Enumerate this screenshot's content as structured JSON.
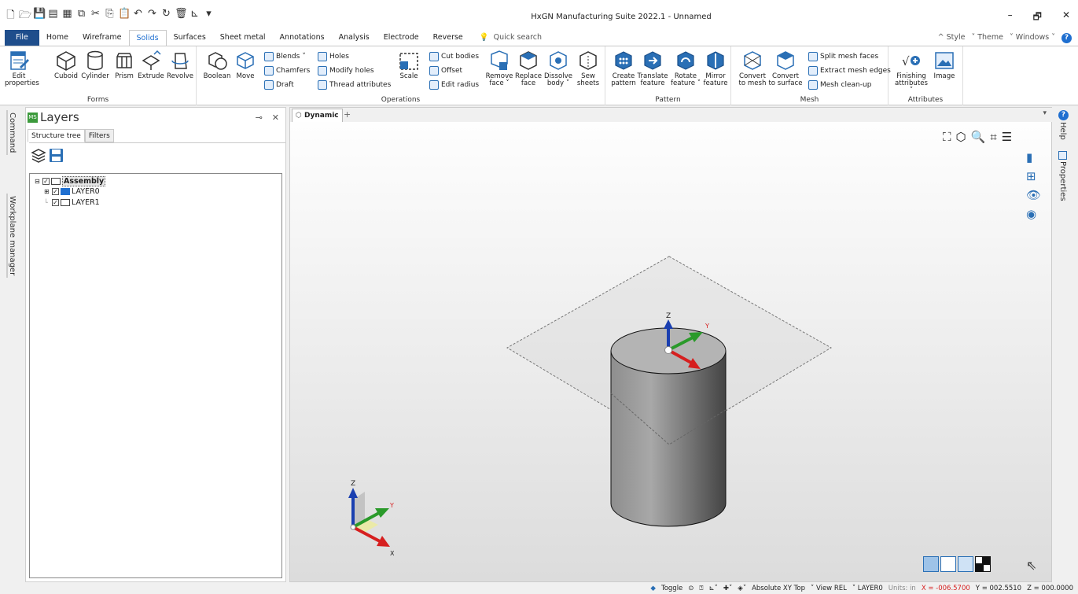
{
  "app": {
    "title": "HxGN Manufacturing Suite 2022.1 - Unnamed"
  },
  "tabs": [
    "File",
    "Home",
    "Wireframe",
    "Solids",
    "Surfaces",
    "Sheet metal",
    "Annotations",
    "Analysis",
    "Electrode",
    "Reverse"
  ],
  "active_tab": "Solids",
  "quick_search": "Quick search",
  "tab_right": {
    "style": "Style",
    "theme": "Theme",
    "windows": "Windows"
  },
  "ribbon": {
    "forms": {
      "label": "Forms",
      "edit": "Edit",
      "edit2": "properties",
      "cuboid": "Cuboid",
      "cylinder": "Cylinder",
      "prism": "Prism",
      "extrude": "Extrude",
      "revolve": "Revolve"
    },
    "operations": {
      "label": "Operations",
      "boolean": "Boolean",
      "move": "Move",
      "blends": "Blends",
      "chamfers": "Chamfers",
      "draft": "Draft",
      "holes": "Holes",
      "modify_holes": "Modify holes",
      "thread": "Thread attributes",
      "scale": "Scale",
      "cut": "Cut bodies",
      "offset": "Offset",
      "edit_radius": "Edit radius",
      "remove": "Remove",
      "remove2": "face",
      "replace": "Replace",
      "replace2": "face",
      "dissolve": "Dissolve",
      "dissolve2": "body",
      "sew": "Sew",
      "sew2": "sheets"
    },
    "pattern": {
      "label": "Pattern",
      "create": "Create",
      "create2": "pattern",
      "translate": "Translate",
      "translate2": "feature",
      "rotate": "Rotate",
      "rotate2": "feature",
      "mirror": "Mirror",
      "mirror2": "feature"
    },
    "mesh": {
      "label": "Mesh",
      "convert1": "Convert",
      "convert1b": "to mesh",
      "convert2": "Convert",
      "convert2b": "to surface",
      "split": "Split mesh faces",
      "extract": "Extract mesh edges",
      "cleanup": "Mesh clean-up"
    },
    "attributes": {
      "label": "Attributes",
      "finishing": "Finishing",
      "finishing2": "attributes",
      "image": "Image"
    }
  },
  "left_strip": {
    "command": "Command",
    "workplane": "Workplane manager"
  },
  "layers": {
    "title": "Layers",
    "tab_tree": "Structure tree",
    "tab_filters": "Filters",
    "assembly": "Assembly",
    "layer0": "LAYER0",
    "layer1": "LAYER1"
  },
  "viewport": {
    "tab": "Dynamic",
    "plus": "+",
    "axes": {
      "z": "Z",
      "y": "Y",
      "x": "X"
    }
  },
  "right_strip": {
    "help": "Help",
    "properties": "Properties"
  },
  "status": {
    "toggle": "Toggle",
    "absolute": "Absolute XY Top",
    "view": "View REL",
    "layer": "LAYER0",
    "units": "Units: in",
    "x": "X = -006.5700",
    "y": "Y = 002.5510",
    "z": "Z = 000.0000"
  },
  "colors": {
    "accent": "#1f6fd0",
    "file_tab": "#1f4e8c",
    "x_axis": "#d61f1f",
    "y_axis": "#2a9a2a",
    "z_axis": "#1a3fb0"
  }
}
